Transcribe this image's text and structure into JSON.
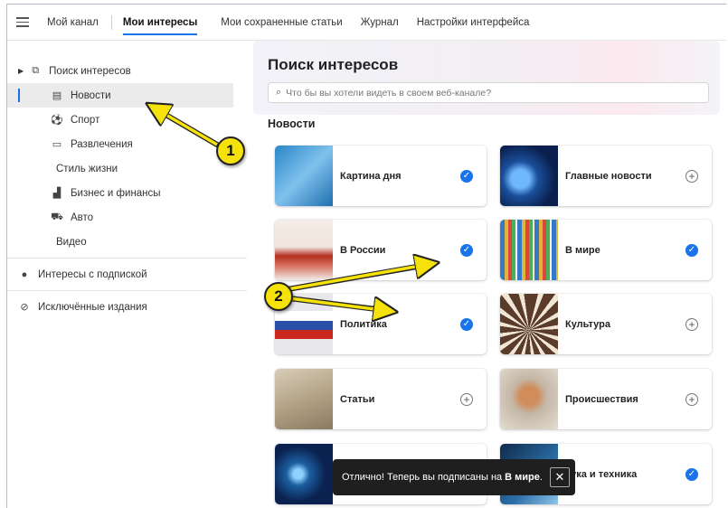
{
  "topnav": {
    "items": [
      {
        "label": "Мой канал"
      },
      {
        "label": "Мои интересы"
      },
      {
        "label": "Мои сохраненные статьи"
      },
      {
        "label": "Журнал"
      },
      {
        "label": "Настройки интерфейса"
      }
    ]
  },
  "sidebar": {
    "root": "Поиск интересов",
    "items": [
      {
        "label": "Новости",
        "icon": "newspaper-icon"
      },
      {
        "label": "Спорт",
        "icon": "ball-icon"
      },
      {
        "label": "Развлечения",
        "icon": "tv-icon"
      },
      {
        "label": "Стиль жизни",
        "icon": ""
      },
      {
        "label": "Бизнес и финансы",
        "icon": "chart-icon"
      },
      {
        "label": "Авто",
        "icon": "car-icon"
      },
      {
        "label": "Видео",
        "icon": ""
      }
    ],
    "subscribed": "Интересы с подпиской",
    "excluded": "Исключённые издания"
  },
  "main": {
    "title": "Поиск интересов",
    "search_placeholder": "Что бы вы хотели видеть в своем веб-канале?",
    "section": "Новости",
    "cards": [
      {
        "label": "Картина дня",
        "subscribed": true
      },
      {
        "label": "Главные новости",
        "subscribed": false
      },
      {
        "label": "В России",
        "subscribed": true
      },
      {
        "label": "В мире",
        "subscribed": true
      },
      {
        "label": "Политика",
        "subscribed": true
      },
      {
        "label": "Культура",
        "subscribed": false
      },
      {
        "label": "Статьи",
        "subscribed": false
      },
      {
        "label": "Происшествия",
        "subscribed": false
      },
      {
        "label": "",
        "subscribed": false
      },
      {
        "label": "аука и техника",
        "subscribed": true
      }
    ]
  },
  "toast": {
    "text": "Отлично! Теперь вы подписаны на",
    "bold": "В мире",
    "period": "."
  },
  "annotations": {
    "badge1": "1",
    "badge2": "2"
  },
  "colors": {
    "accent": "#1a73e8",
    "badge": "#f5e20a",
    "arrow": "#f5e20a"
  }
}
